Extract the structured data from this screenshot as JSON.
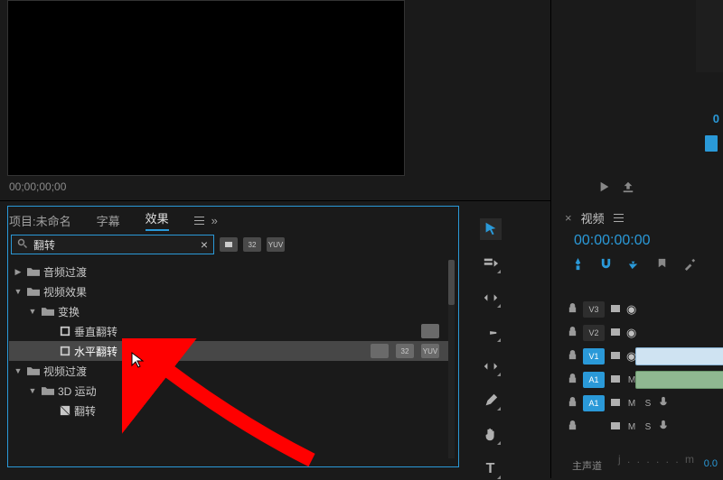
{
  "monitor": {
    "timecode": "00;00;00;00",
    "right_timecode": "0"
  },
  "project_panel": {
    "tabs": {
      "project": "项目:未命名",
      "subtitles": "字幕",
      "effects": "效果"
    },
    "search": {
      "value": "翻转",
      "placeholder": ""
    },
    "filter_badges": {
      "a": "",
      "b": "32",
      "c": "YUV"
    },
    "tree": {
      "audio_transitions": "音频过渡",
      "video_effects": "视频效果",
      "transform": "变换",
      "vertical_flip": "垂直翻转",
      "horizontal_flip": "水平翻转",
      "video_transitions": "视频过渡",
      "three_d_motion": "3D 运动",
      "flip": "翻转"
    }
  },
  "timeline": {
    "title": "视频",
    "playhead_tc": "00:00:00:00",
    "tracks": {
      "v3": "V3",
      "v2": "V2",
      "v1": "V1",
      "a1": "A1",
      "a1b": "A1",
      "m": "M",
      "s": "S"
    },
    "bottom_label": "主声道",
    "bottom_value": "0.0"
  },
  "watermark": "j . . . . . . m"
}
